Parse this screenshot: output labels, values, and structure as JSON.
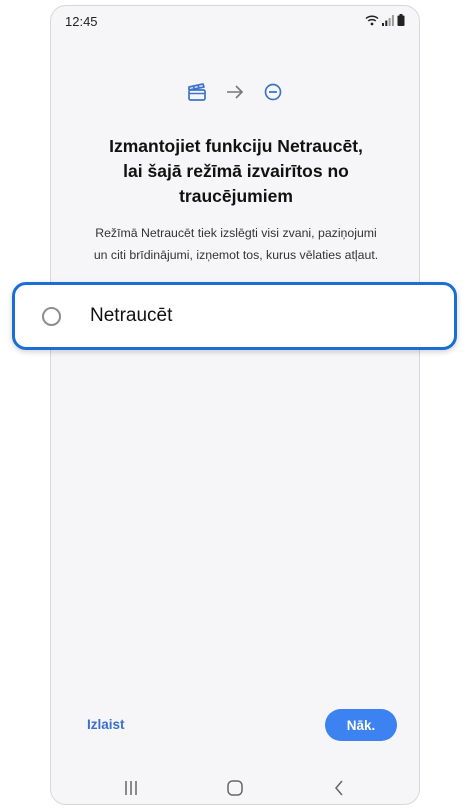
{
  "status_bar": {
    "time": "12:45",
    "icons": [
      "wifi-icon",
      "signal-icon",
      "battery-icon"
    ]
  },
  "illustration": {
    "icons": [
      "clapperboard-icon",
      "arrow-right-icon",
      "do-not-disturb-icon"
    ],
    "accent_color": "#3b74c9"
  },
  "headline": {
    "line1": "Izmantojiet funkciju Netraucēt,",
    "line2": "lai šajā režīmā izvairītos no",
    "line3": "traucējumiem"
  },
  "description": {
    "line1": "Režīmā Netraucēt tiek izslēgti visi zvani, paziņojumi",
    "line2": "un citi brīdinājumi, izņemot tos, kurus vēlaties atļaut."
  },
  "option": {
    "label": "Netraucēt",
    "selected": false,
    "highlight_color": "#1b6ed8"
  },
  "actions": {
    "skip_label": "Izlaist",
    "next_label": "Nāk.",
    "next_color": "#3c82f0"
  },
  "nav_bar": {
    "icons": [
      "recent-apps-icon",
      "home-icon",
      "back-icon"
    ]
  }
}
